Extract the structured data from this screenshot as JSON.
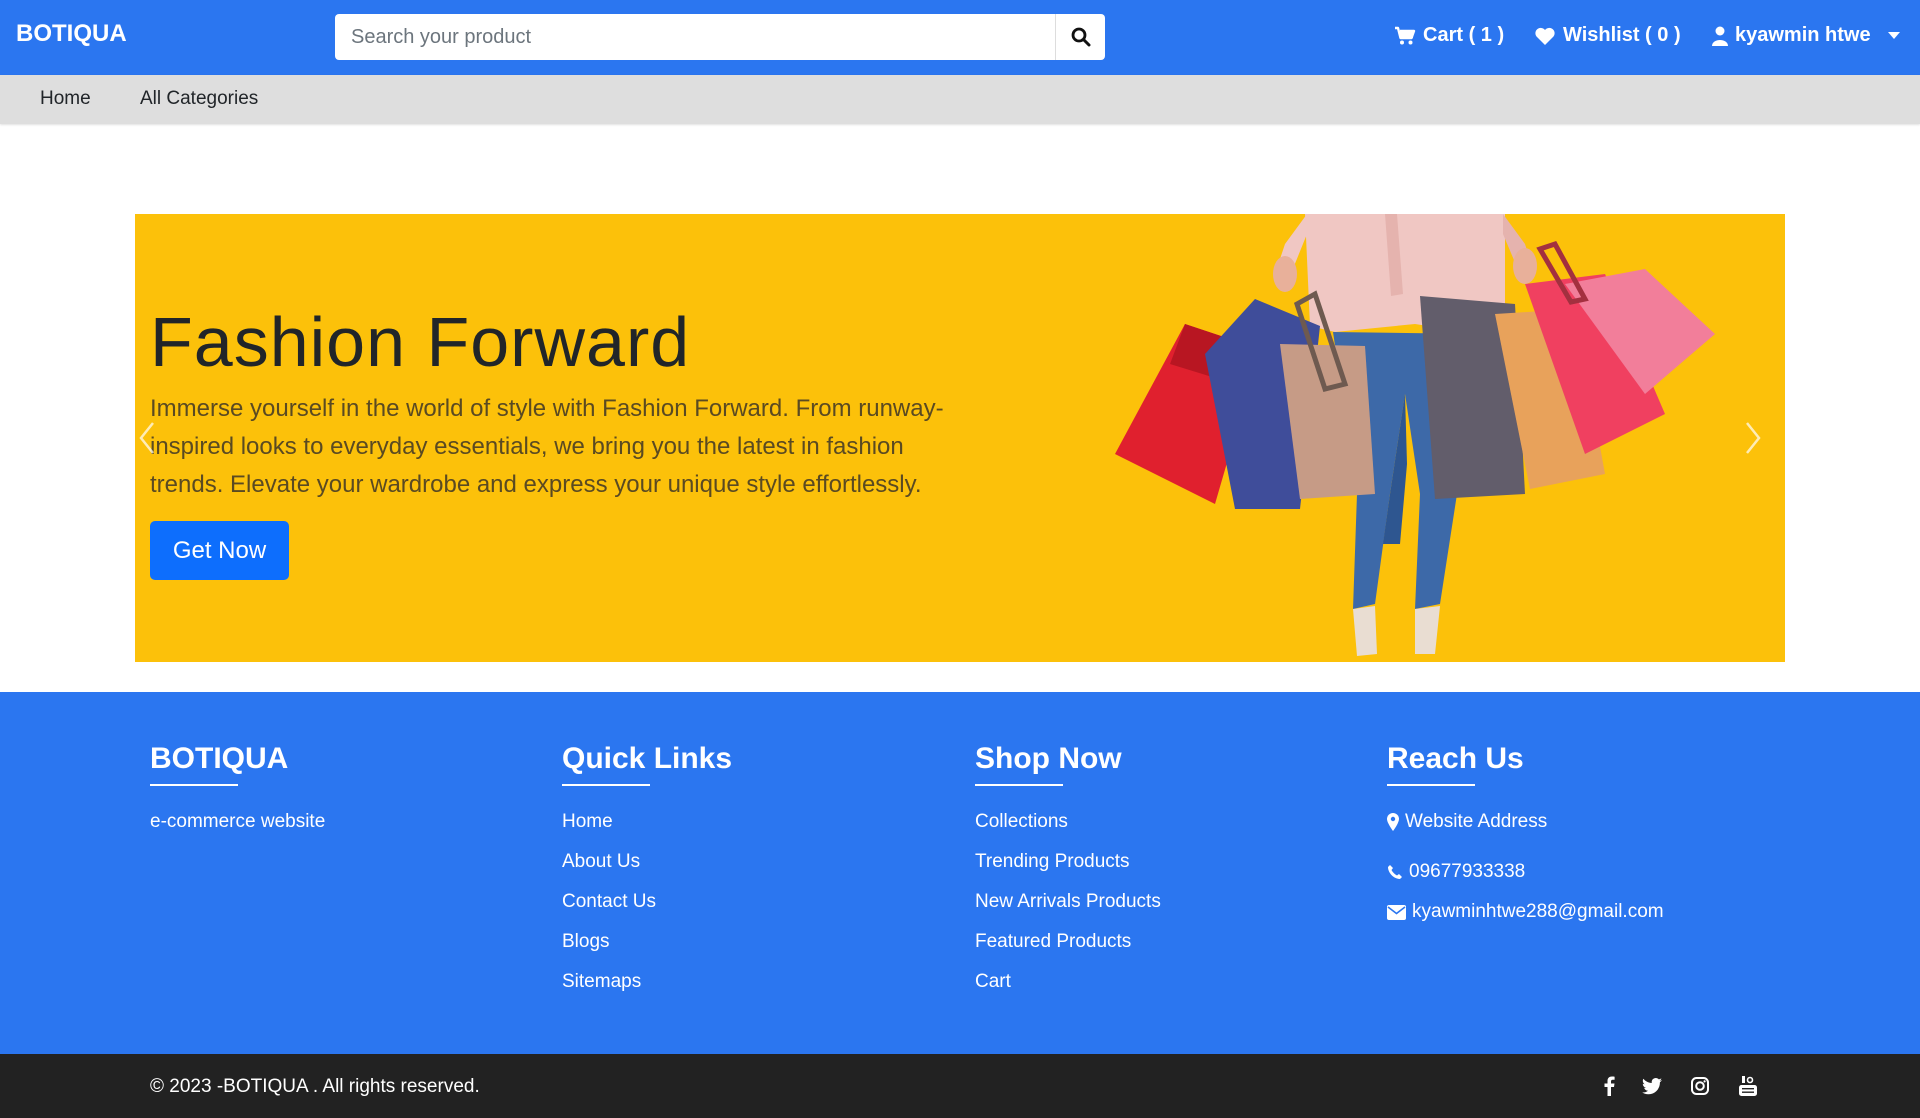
{
  "header": {
    "brand": "BOTIQUA",
    "search_placeholder": "Search your product",
    "cart_label": "Cart ( 1 )",
    "wishlist_label": "Wishlist ( 0 )",
    "user_label": "kyawmin htwe"
  },
  "subnav": {
    "items": [
      {
        "label": "Home"
      },
      {
        "label": "All Categories"
      }
    ]
  },
  "hero": {
    "title": "Fashion Forward",
    "text": "Immerse yourself in the world of style with Fashion Forward. From runway-inspired looks to everyday essentials, we bring you the latest in fashion trends. Elevate your wardrobe and express your unique style effortlessly.",
    "button_label": "Get Now",
    "background_color": "#fcc10a"
  },
  "footer": {
    "brand": {
      "title": "BOTIQUA",
      "tagline": "e-commerce website"
    },
    "quick_links": {
      "title": "Quick Links",
      "items": [
        "Home",
        "About Us",
        "Contact Us",
        "Blogs",
        "Sitemaps"
      ]
    },
    "shop_now": {
      "title": "Shop Now",
      "items": [
        "Collections",
        "Trending Products",
        "New Arrivals Products",
        "Featured Products",
        "Cart"
      ]
    },
    "reach_us": {
      "title": "Reach Us",
      "address": "Website Address",
      "phone": "09677933338",
      "email": "kyawminhtwe288@gmail.com"
    },
    "copyright": "© 2023 -BOTIQUA . All rights reserved.",
    "social_icons": [
      "facebook-icon",
      "twitter-icon",
      "instagram-icon",
      "youtube-icon"
    ]
  },
  "colors": {
    "primary": "#2b76f0",
    "button": "#0d6efd",
    "bottom_bar": "#222222"
  }
}
